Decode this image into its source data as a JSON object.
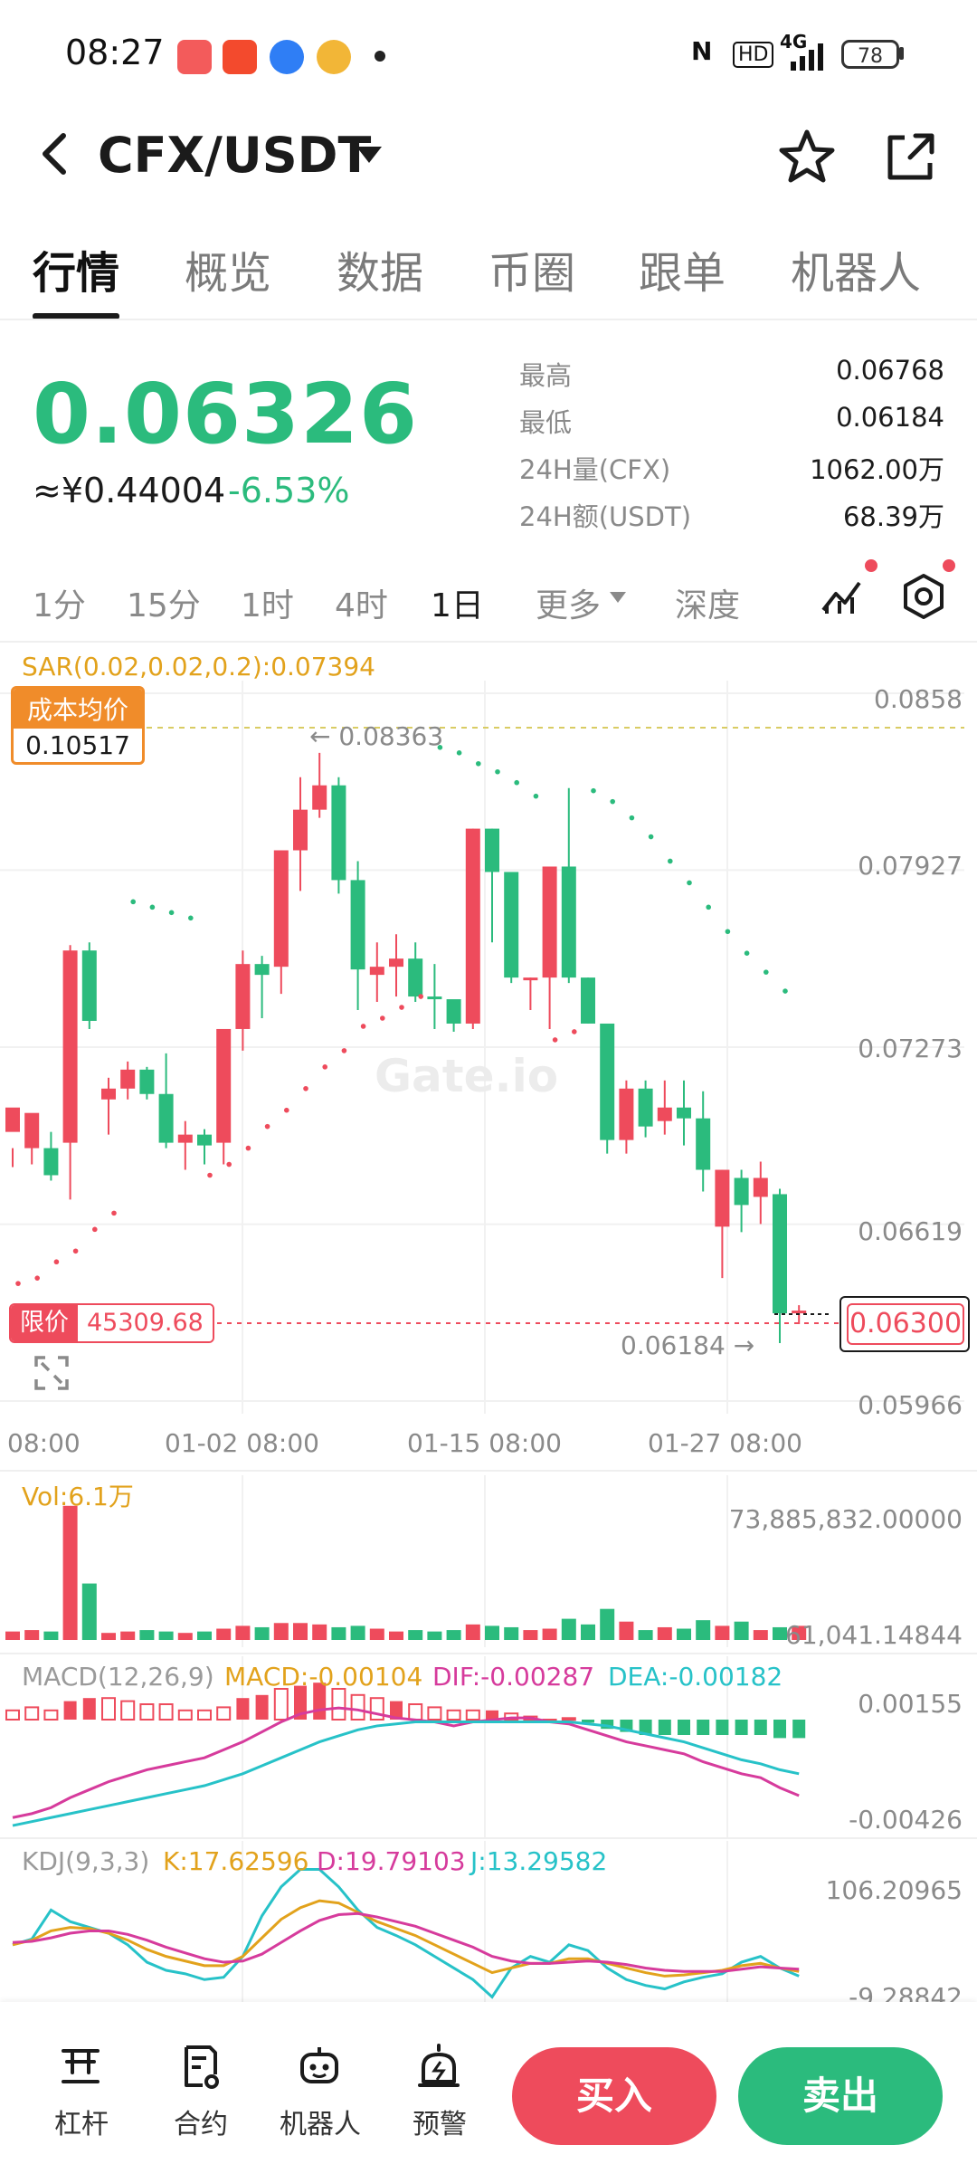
{
  "status_bar": {
    "time": "08:27",
    "battery": "78",
    "network": "4G",
    "hd": "HD"
  },
  "header": {
    "pair": "CFX/USDT"
  },
  "tabs": [
    "行情",
    "概览",
    "数据",
    "币圈",
    "跟单",
    "机器人"
  ],
  "price": {
    "last": "0.06326",
    "cny": "≈¥0.44004",
    "change": "-6.53%"
  },
  "stats": [
    {
      "label": "最高",
      "value": "0.06768"
    },
    {
      "label": "最低",
      "value": "0.06184"
    },
    {
      "label": "24H量(CFX)",
      "value": "1062.00万"
    },
    {
      "label": "24H额(USDT)",
      "value": "68.39万"
    }
  ],
  "timeframes": [
    "1分",
    "15分",
    "1时",
    "4时",
    "1日"
  ],
  "timeframe_active": "1日",
  "more_label": "更多",
  "depth_label": "深度",
  "indicator_sar": "SAR(0.02,0.02,0.2):0.07394",
  "cost": {
    "label": "成本均价",
    "value": "0.10517"
  },
  "limit": {
    "label": "限价",
    "value": "45309.68"
  },
  "chart_labels": {
    "high_marker": "← 0.08363",
    "low_marker": "0.06184 →",
    "current_price": "0.06300",
    "watermark": "Gate.io"
  },
  "vol": {
    "label": "Vol:6.1万",
    "max": "73,885,832.00000",
    "min": "61,041.14844"
  },
  "macd": {
    "params": "MACD(12,26,9)",
    "macd": "MACD:-0.00104",
    "dif": "DIF:-0.00287",
    "dea": "DEA:-0.00182",
    "max": "0.00155",
    "min": "-0.00426"
  },
  "kdj": {
    "params": "KDJ(9,3,3)",
    "k": "K:17.62596",
    "d": "D:19.79103",
    "j": "J:13.29582",
    "max": "106.20965",
    "min": "-9.28842"
  },
  "bottom_nav": [
    "杠杆",
    "合约",
    "机器人",
    "预警"
  ],
  "actions": {
    "buy": "买入",
    "sell": "卖出"
  },
  "colors": {
    "up": "#2bbb7d",
    "down": "#ee4b5c",
    "accent": "#f08c2a",
    "sar": "#e2a21c"
  },
  "chart_data": {
    "type": "candlestick",
    "interval": "1日",
    "y_axis_ticks": [
      0.0858,
      0.07927,
      0.07273,
      0.06619,
      0.05966
    ],
    "ylim": [
      0.05966,
      0.0858
    ],
    "x_tick_labels": [
      "08:00",
      "01-02 08:00",
      "01-15 08:00",
      "01-27 08:00"
    ],
    "cost_line": 0.10517,
    "current_price": 0.063,
    "period_high": 0.08363,
    "period_low": 0.06184,
    "candles": [
      [
        0.0696,
        0.0705,
        0.0683,
        0.069
      ],
      [
        0.069,
        0.0703,
        0.0684,
        0.0697
      ],
      [
        0.069,
        0.068,
        0.0678,
        0.0696
      ],
      [
        0.0692,
        0.0763,
        0.0671,
        0.0765
      ],
      [
        0.0763,
        0.0737,
        0.0734,
        0.0766
      ],
      [
        0.0708,
        0.0712,
        0.0695,
        0.0716
      ],
      [
        0.0712,
        0.0719,
        0.0708,
        0.0722
      ],
      [
        0.0719,
        0.071,
        0.0708,
        0.072
      ],
      [
        0.071,
        0.0692,
        0.069,
        0.0725
      ],
      [
        0.0692,
        0.0695,
        0.0682,
        0.07
      ],
      [
        0.0695,
        0.0691,
        0.0684,
        0.0697
      ],
      [
        0.0692,
        0.0734,
        0.0684,
        0.0734
      ],
      [
        0.0734,
        0.0758,
        0.0726,
        0.0763
      ],
      [
        0.0758,
        0.0754,
        0.0738,
        0.0761
      ],
      [
        0.0757,
        0.08,
        0.0747,
        0.08
      ],
      [
        0.08,
        0.0815,
        0.0785,
        0.0827
      ],
      [
        0.0815,
        0.0824,
        0.0812,
        0.0836
      ],
      [
        0.0824,
        0.0789,
        0.0784,
        0.0827
      ],
      [
        0.0789,
        0.0756,
        0.0741,
        0.0796
      ],
      [
        0.0754,
        0.0757,
        0.0744,
        0.0766
      ],
      [
        0.0757,
        0.076,
        0.0746,
        0.0769
      ],
      [
        0.076,
        0.0746,
        0.0744,
        0.0766
      ],
      [
        0.0746,
        0.0745,
        0.0734,
        0.0758
      ],
      [
        0.0745,
        0.0736,
        0.0733,
        0.0743
      ],
      [
        0.0736,
        0.0808,
        0.0734,
        0.0808
      ],
      [
        0.0808,
        0.0792,
        0.0766,
        0.0808
      ],
      [
        0.0792,
        0.0753,
        0.0751,
        0.0792
      ],
      [
        0.0753,
        0.0753,
        0.0741,
        0.0753
      ],
      [
        0.0753,
        0.0794,
        0.0734,
        0.0792
      ],
      [
        0.0794,
        0.0753,
        0.0751,
        0.0823
      ],
      [
        0.0753,
        0.0736,
        0.0736,
        0.0753
      ],
      [
        0.0736,
        0.0693,
        0.0688,
        0.0736
      ],
      [
        0.0693,
        0.0712,
        0.0688,
        0.0715
      ],
      [
        0.0712,
        0.0698,
        0.0694,
        0.0715
      ],
      [
        0.07,
        0.0705,
        0.0695,
        0.0715
      ],
      [
        0.0705,
        0.0701,
        0.0691,
        0.0715
      ],
      [
        0.0701,
        0.0682,
        0.0674,
        0.0711
      ],
      [
        0.0661,
        0.0682,
        0.0642,
        0.0682
      ],
      [
        0.0679,
        0.0669,
        0.0659,
        0.0682
      ],
      [
        0.0672,
        0.0679,
        0.0662,
        0.0685
      ],
      [
        0.0673,
        0.0629,
        0.0618,
        0.0675
      ],
      [
        0.0629,
        0.063,
        0.0625,
        0.0632
      ]
    ]
  }
}
